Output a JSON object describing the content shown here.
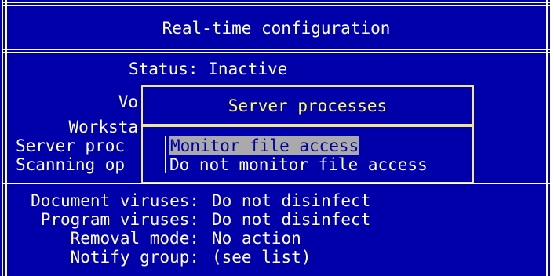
{
  "window": {
    "title": "Real-time configuration",
    "status_label": "Status:",
    "status_value": "Inactive",
    "fields_left": [
      {
        "label": "Vo"
      },
      {
        "label": "Worksta"
      },
      {
        "label": "Server proc"
      },
      {
        "label": "Scanning op"
      }
    ],
    "settings": [
      {
        "label": "Document viruses:",
        "value": "Do not disinfect"
      },
      {
        "label": "Program viruses:",
        "value": "Do not disinfect"
      },
      {
        "label": "Removal mode:",
        "value": "No action"
      },
      {
        "label": "Notify group:",
        "value": "(see list)"
      }
    ]
  },
  "popup": {
    "title": "Server processes",
    "options": [
      {
        "label": "Monitor file access",
        "selected": true
      },
      {
        "label": "Do not monitor file access",
        "selected": false
      }
    ]
  },
  "colors": {
    "background": "#0000aa",
    "text": "#ffffff",
    "popup_title": "#ffff55",
    "popup_border": "#f0e68c",
    "highlight_bg": "#aaaaaa",
    "highlight_fg": "#0000aa"
  }
}
